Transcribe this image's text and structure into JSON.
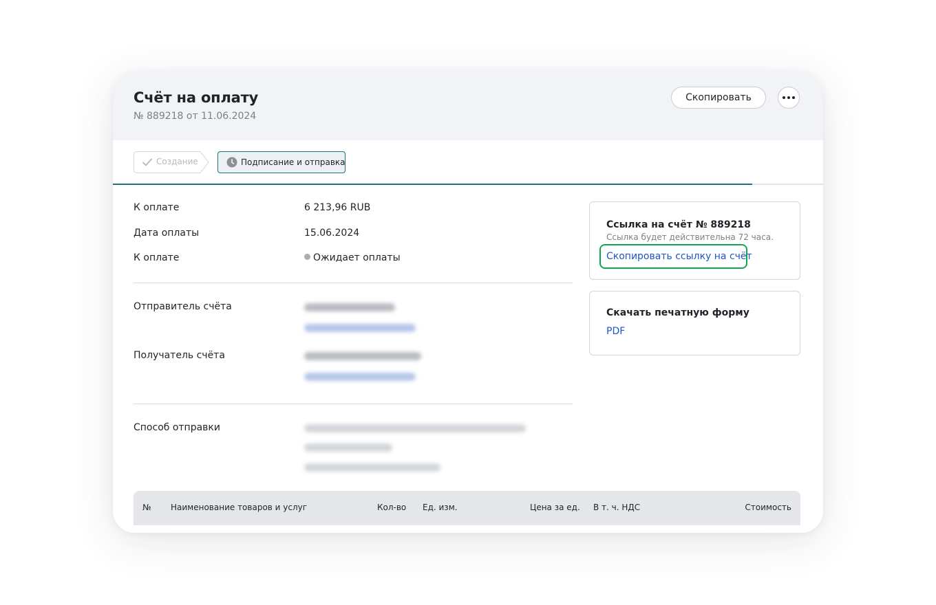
{
  "header": {
    "title": "Счёт на оплату",
    "subtitle": "№ 889218 от 11.06.2024",
    "copy_label": "Скопировать",
    "more_icon": "more-horizontal-icon"
  },
  "steps": {
    "items": [
      {
        "label": "Создание",
        "state": "done",
        "icon": "check-icon"
      },
      {
        "label": "Подписание и отправка",
        "state": "active",
        "icon": "clock-icon"
      }
    ],
    "progress_percent": 90,
    "accent": "#1e6f86"
  },
  "details": {
    "amount_label": "К оплате",
    "amount_value": "6 213,96 RUB",
    "date_label": "Дата оплаты",
    "date_value": "15.06.2024",
    "status_label": "К оплате",
    "status_value": "Ожидает оплаты",
    "sender_label": "Отправитель счёта",
    "recipient_label": "Получатель счёта",
    "delivery_label": "Способ отправки"
  },
  "link_card": {
    "title": "Ссылка на счёт № 889218",
    "note": "Ссылка будет действительна 72 часа.",
    "copy_link_label": "Скопировать ссылку на счёт"
  },
  "print_card": {
    "title": "Скачать печатную форму",
    "pdf_label": "PDF"
  },
  "table": {
    "columns": [
      "№",
      "Наименование товаров и услуг",
      "Кол-во",
      "Ед. изм.",
      "Цена за ед.",
      "В т. ч. НДС",
      "Стоимость"
    ]
  },
  "colors": {
    "header_bg": "#f2f3f6",
    "link": "#1e55c4",
    "focus_ring": "#10a64a"
  }
}
